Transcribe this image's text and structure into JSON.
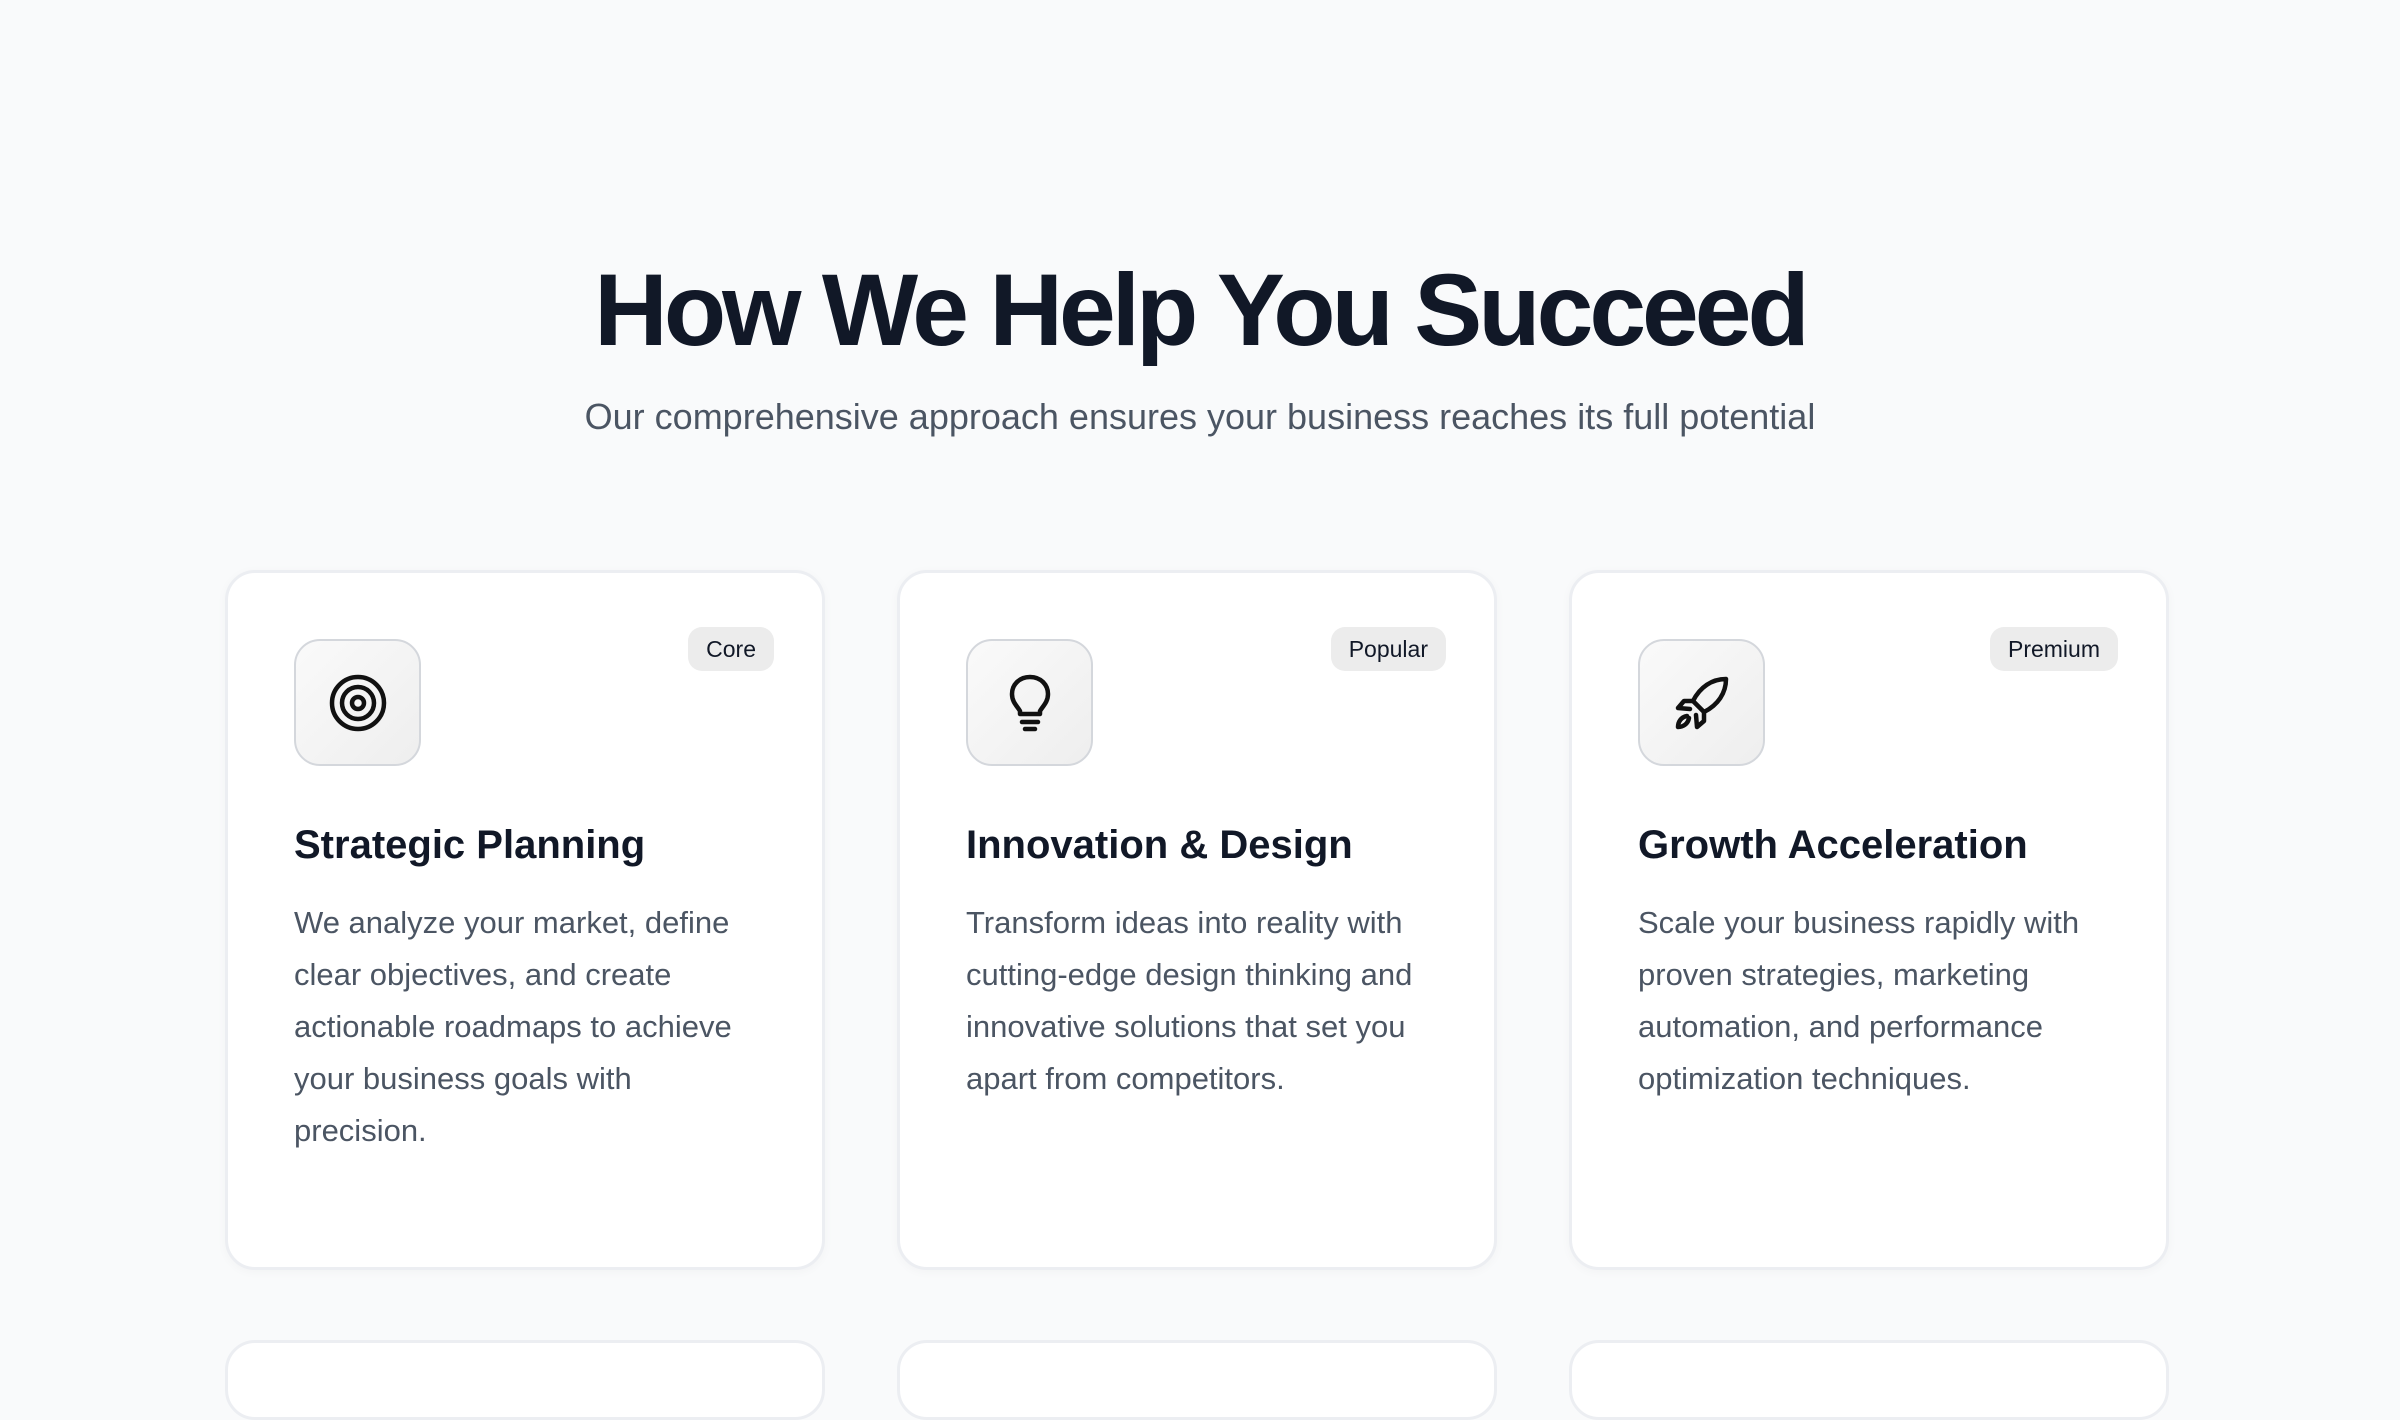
{
  "section": {
    "title": "How We Help You Succeed",
    "subtitle": "Our comprehensive approach ensures your business reaches its full potential"
  },
  "cards": [
    {
      "icon": "target-icon",
      "badge": "Core",
      "title": "Strategic Planning",
      "description": "We analyze your market, define clear objectives, and create actionable roadmaps to achieve your business goals with precision."
    },
    {
      "icon": "lightbulb-icon",
      "badge": "Popular",
      "title": "Innovation & Design",
      "description": "Transform ideas into reality with cutting-edge design thinking and innovative solutions that set you apart from competitors."
    },
    {
      "icon": "rocket-icon",
      "badge": "Premium",
      "title": "Growth Acceleration",
      "description": "Scale your business rapidly with proven strategies, marketing automation, and performance optimization techniques."
    }
  ],
  "colors": {
    "page_background": "#f9fafb",
    "heading": "#111827",
    "body_text": "#4b5563",
    "badge_background": "#ececec"
  }
}
